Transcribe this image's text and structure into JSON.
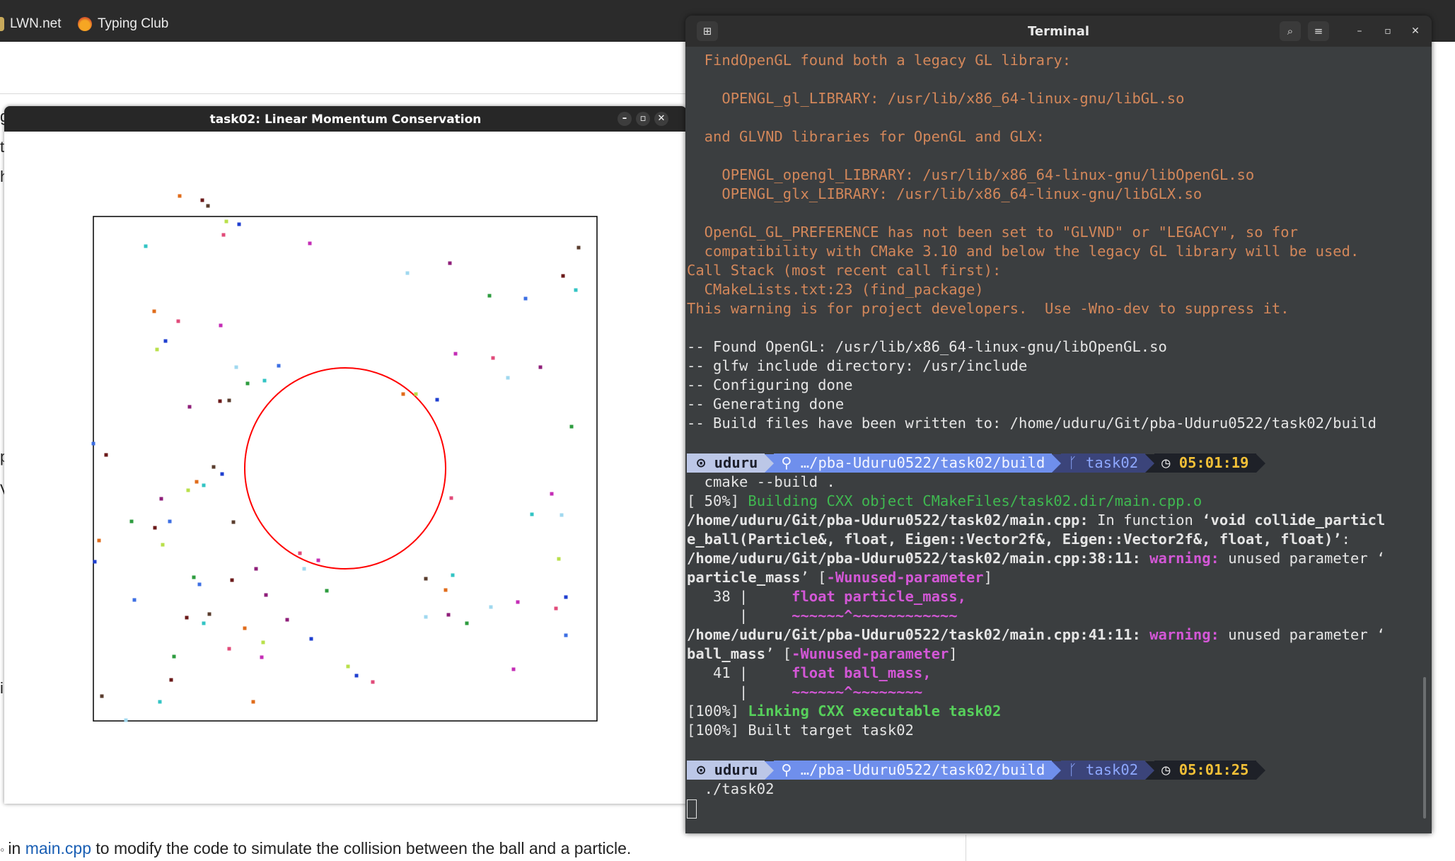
{
  "browser": {
    "bookmarks": [
      {
        "label": "LWN.net",
        "icon": "lwn-icon"
      },
      {
        "label": "Typing Club",
        "icon": "typing-club-icon"
      }
    ],
    "page_text": {
      "prefix": "in ",
      "link": "main.cpp",
      "suffix": " to modify the code to simulate the collision between the ball and a particle."
    }
  },
  "sim_window": {
    "title": "task02: Linear Momentum Conservation",
    "controls": [
      "minimize",
      "maximize",
      "close"
    ],
    "ball_color": "#ff0000",
    "particle_colors": [
      "#e06c1b",
      "#2e9c3f",
      "#1f3fd0",
      "#6b1a1a",
      "#c42db6",
      "#33c4c4",
      "#8f1f7a",
      "#b9e04b",
      "#3d6fe3",
      "#e14b7a",
      "#5a3d2e",
      "#a0d8ef"
    ]
  },
  "terminal": {
    "title": "Terminal",
    "lines": {
      "l1": "  FindOpenGL found both a legacy GL library:",
      "l2": "",
      "l3": "    OPENGL_gl_LIBRARY: /usr/lib/x86_64-linux-gnu/libGL.so",
      "l4": "",
      "l5": "  and GLVND libraries for OpenGL and GLX:",
      "l6": "",
      "l7": "    OPENGL_opengl_LIBRARY: /usr/lib/x86_64-linux-gnu/libOpenGL.so",
      "l8": "    OPENGL_glx_LIBRARY: /usr/lib/x86_64-linux-gnu/libGLX.so",
      "l9": "",
      "l10": "  OpenGL_GL_PREFERENCE has not been set to \"GLVND\" or \"LEGACY\", so for",
      "l11": "  compatibility with CMake 3.10 and below the legacy GL library will be used.",
      "l12": "Call Stack (most recent call first):",
      "l13": "  CMakeLists.txt:23 (find_package)",
      "l14": "This warning is for project developers.  Use -Wno-dev to suppress it.",
      "l15": "",
      "l16": "-- Found OpenGL: /usr/lib/x86_64-linux-gnu/libOpenGL.so",
      "l17": "-- glfw include directory: /usr/include",
      "l18": "-- Configuring done",
      "l19": "-- Generating done",
      "l20": "-- Build files have been written to: /home/uduru/Git/pba-Uduru0522/task02/build"
    },
    "prompt1": {
      "user": "⊙ uduru",
      "path": "…/pba-Uduru0522/task02/build",
      "branch": "task02",
      "time": "05:01:19"
    },
    "cmd1": "  cmake --build .",
    "build": {
      "b1_prefix": "[ 50%] ",
      "b1_msg": "Building CXX object CMakeFiles/task02.dir/main.cpp.o",
      "b2_path": "/home/uduru/Git/pba-Uduru0522/task02/main.cpp:",
      "b2_mid": " In function ",
      "b2_func": "‘void collide_particl",
      "b3": "e_ball(Particle&, float, Eigen::Vector2f&, Eigen::Vector2f&, float, float)’",
      "b3_tail": ":",
      "w1_path": "/home/uduru/Git/pba-Uduru0522/task02/main.cpp:38:11:",
      "w1_warn": "warning:",
      "w1_msg": " unused parameter ‘",
      "w1b_name": "particle_mass",
      "w1b_mid": "’ [",
      "w1b_flag": "-Wunused-parameter",
      "w1b_end": "]",
      "w1c_num": "   38 |     ",
      "w1c_code": "float particle_mass,",
      "w1d_pipe": "      |     ",
      "w1d_mark": "~~~~~~^~~~~~~~~~~~~",
      "w2_path": "/home/uduru/Git/pba-Uduru0522/task02/main.cpp:41:11:",
      "w2_warn": "warning:",
      "w2_msg": " unused parameter ‘",
      "w2b_name": "ball_mass",
      "w2b_mid": "’ [",
      "w2b_flag": "-Wunused-parameter",
      "w2b_end": "]",
      "w2c_num": "   41 |     ",
      "w2c_code": "float ball_mass,",
      "w2d_pipe": "      |     ",
      "w2d_mark": "~~~~~~^~~~~~~~~",
      "link_prefix": "[100%] ",
      "link_msg": "Linking CXX executable task02",
      "built": "[100%] Built target task02"
    },
    "prompt2": {
      "user": "⊙ uduru",
      "path": "…/pba-Uduru0522/task02/build",
      "branch": "task02",
      "time": "05:01:25"
    },
    "cmd2": "  ./task02"
  }
}
